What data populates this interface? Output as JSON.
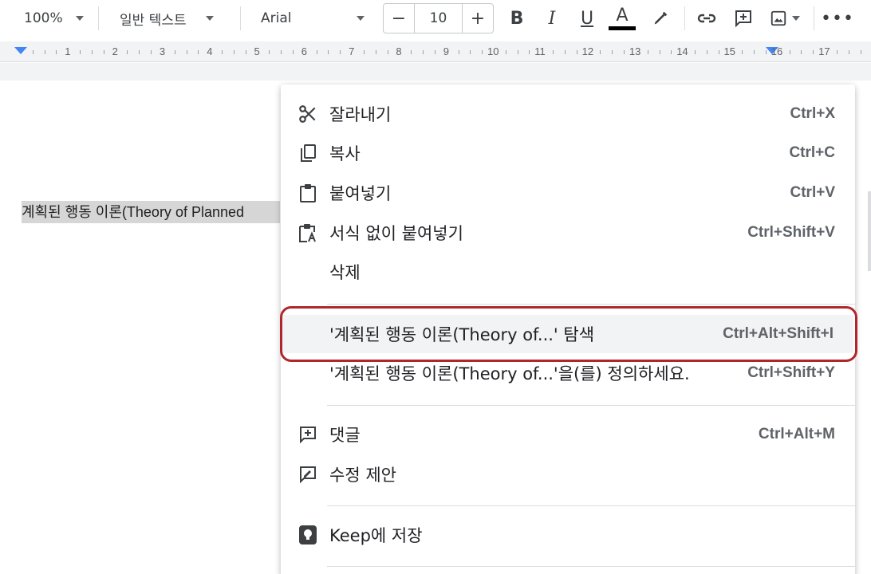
{
  "toolbar": {
    "zoom": "100%",
    "style": "일반 텍스트",
    "font": "Arial",
    "font_size": "10",
    "minus": "−",
    "plus": "+",
    "bold": "B",
    "italic": "I",
    "underline": "U",
    "text_color": "A",
    "icons": [
      "highlighter-icon",
      "link-icon",
      "add-comment-icon",
      "image-icon",
      "more-icon"
    ]
  },
  "ruler": {
    "numbers": [
      "1",
      "2",
      "3",
      "4",
      "5",
      "6",
      "7",
      "8",
      "9",
      "10",
      "11",
      "12",
      "13",
      "14",
      "15",
      "16",
      "17"
    ]
  },
  "document": {
    "selected_text": "계획된 행동 이론(Theory of Planned"
  },
  "menu": {
    "items": [
      {
        "label": "잘라내기",
        "shortcut": "Ctrl+X",
        "icon": "cut-icon"
      },
      {
        "label": "복사",
        "shortcut": "Ctrl+C",
        "icon": "copy-icon"
      },
      {
        "label": "붙여넣기",
        "shortcut": "Ctrl+V",
        "icon": "paste-icon"
      },
      {
        "label": "서식 없이 붙여넣기",
        "shortcut": "Ctrl+Shift+V",
        "icon": "paste-plain-icon"
      },
      {
        "label": "삭제",
        "shortcut": "",
        "icon": ""
      },
      {
        "label": "'계획된 행동 이론(Theory of...' 탐색",
        "shortcut": "Ctrl+Alt+Shift+I",
        "icon": ""
      },
      {
        "label": "'계획된 행동 이론(Theory of...'을(를) 정의하세요.",
        "shortcut": "Ctrl+Shift+Y",
        "icon": ""
      },
      {
        "label": "댓글",
        "shortcut": "Ctrl+Alt+M",
        "icon": "comment-icon"
      },
      {
        "label": "수정 제안",
        "shortcut": "",
        "icon": "suggest-edit-icon"
      },
      {
        "label": "Keep에 저장",
        "shortcut": "",
        "icon": "keep-icon"
      }
    ]
  },
  "colors": {
    "highlight_border": "#b0272b",
    "ruler_marker": "#4285f4",
    "hover_bg": "#f1f3f4"
  }
}
